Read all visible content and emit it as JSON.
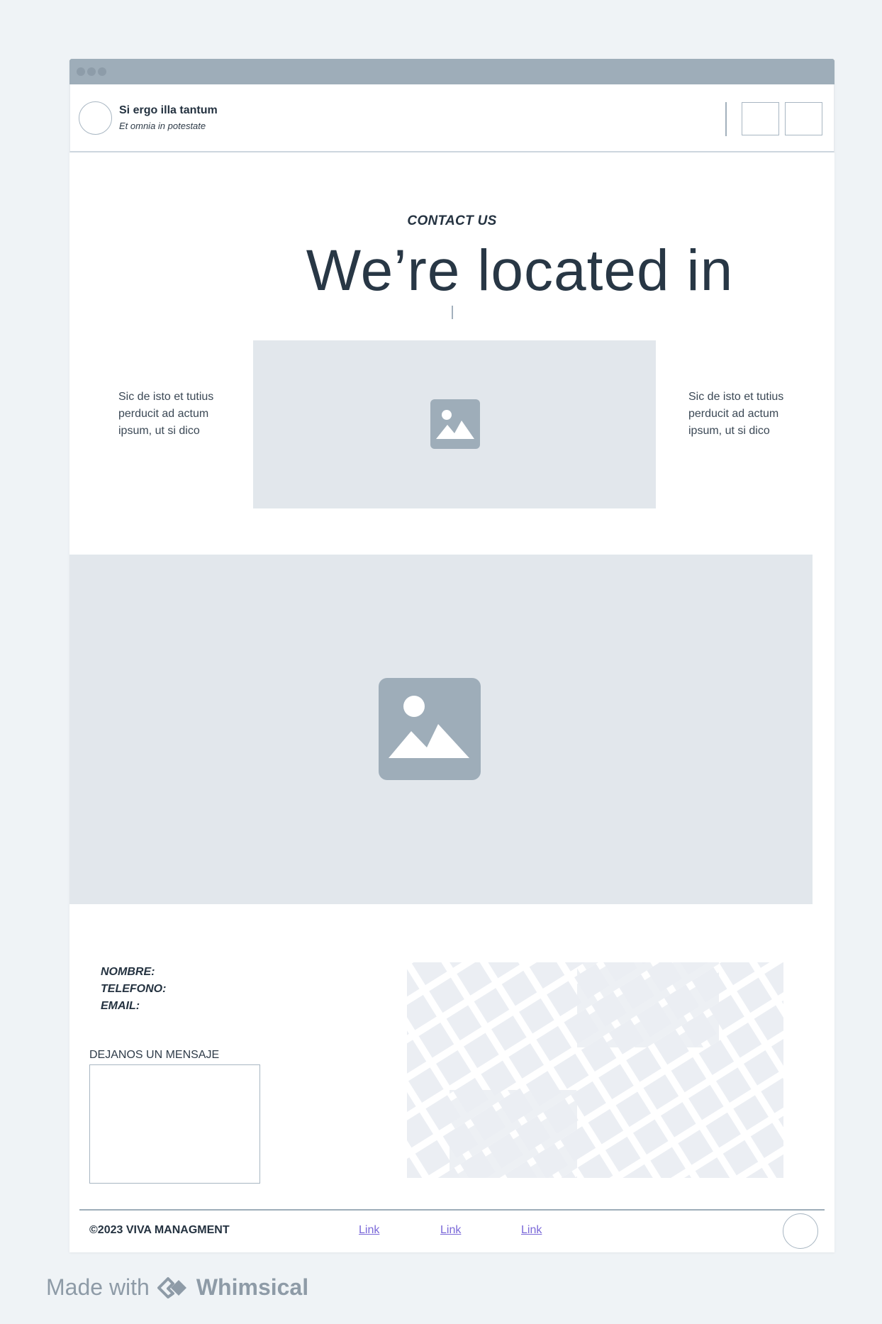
{
  "header": {
    "brand_title": "Si ergo illa tantum",
    "brand_subtitle": "Et omnia in potestate"
  },
  "hero": {
    "eyebrow": "CONTACT US",
    "headline": "We’re located in",
    "left_text": "Sic de isto et tutius perducit ad actum ipsum, ut si dico",
    "right_text": "Sic de isto et tutius perducit ad actum ipsum, ut si dico"
  },
  "contact": {
    "fields": [
      "NOMBRE:",
      "TELEFONO:",
      "EMAIL:"
    ],
    "message_label": "DEJANOS UN MENSAJE"
  },
  "footer": {
    "copyright": "©2023 VIVA MANAGMENT",
    "links": [
      "Link",
      "Link",
      "Link"
    ]
  },
  "made_with": {
    "prefix": "Made with",
    "brand": "Whimsical"
  },
  "colors": {
    "titlebar": "#9eadb9",
    "placeholder_bg": "#e2e7ec",
    "placeholder_icon": "#9eadb9",
    "link": "#7a68d8",
    "map_block": "#ebeef3"
  },
  "icons": [
    "image-placeholder-icon",
    "map-placeholder-icon",
    "whimsical-logo-icon"
  ]
}
